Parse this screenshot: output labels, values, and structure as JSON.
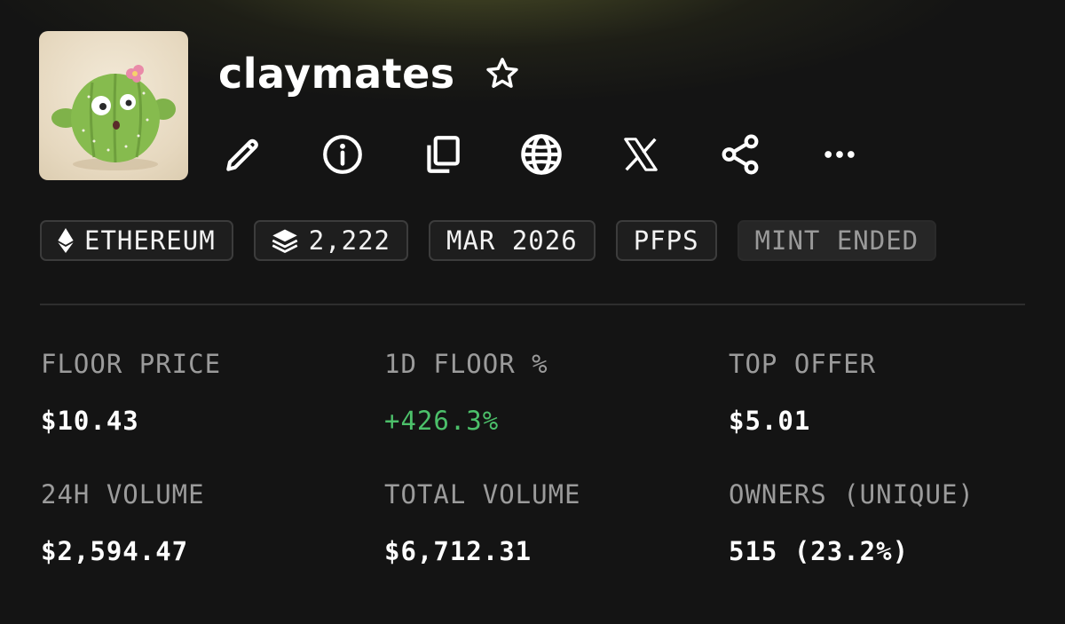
{
  "collection": {
    "name": "claymates"
  },
  "actions": [
    {
      "icon": "pencil-icon",
      "label": "edit"
    },
    {
      "icon": "info-icon",
      "label": "info"
    },
    {
      "icon": "copy-icon",
      "label": "copy"
    },
    {
      "icon": "globe-icon",
      "label": "website"
    },
    {
      "icon": "x-logo-icon",
      "label": "X"
    },
    {
      "icon": "share-icon",
      "label": "share"
    },
    {
      "icon": "more-icon",
      "label": "more"
    }
  ],
  "chips": {
    "chain": "ETHEREUM",
    "supply": "2,222",
    "date": "MAR 2026",
    "category": "PFPS",
    "status": "MINT ENDED"
  },
  "stats": {
    "floor_price": {
      "label": "FLOOR PRICE",
      "value": "$10.43"
    },
    "floor_change": {
      "label": "1D FLOOR %",
      "value": "+426.3%"
    },
    "top_offer": {
      "label": "TOP OFFER",
      "value": "$5.01"
    },
    "volume_24h": {
      "label": "24H VOLUME",
      "value": "$2,594.47"
    },
    "total_volume": {
      "label": "TOTAL VOLUME",
      "value": "$6,712.31"
    },
    "owners": {
      "label": "OWNERS (UNIQUE)",
      "value": "515 (23.2%)"
    }
  },
  "colors": {
    "background": "#141414",
    "positive": "#4cc06a",
    "label": "#9b9b9b",
    "chip_border": "#3c3c3c"
  }
}
